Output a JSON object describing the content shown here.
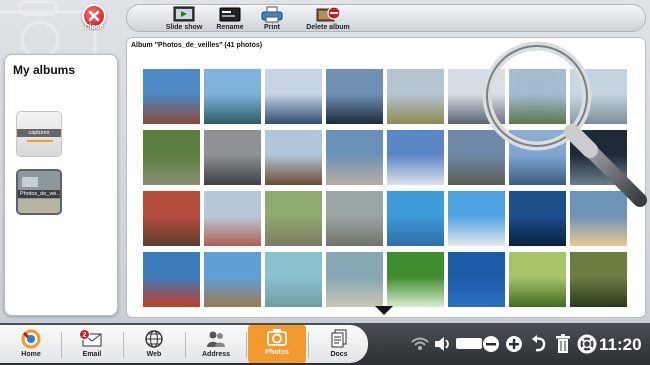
{
  "window": {
    "close_label": "Close"
  },
  "toolbar": {
    "buttons": [
      {
        "label": "Slide show",
        "icon": "slideshow-icon"
      },
      {
        "label": "Rename",
        "icon": "rename-icon"
      },
      {
        "label": "Print",
        "icon": "printer-icon"
      },
      {
        "label": "Delete album",
        "icon": "delete-album-icon"
      }
    ]
  },
  "sidebar": {
    "title": "My albums",
    "albums": [
      {
        "label": "captures"
      },
      {
        "label": "Photos_de_vei..."
      }
    ]
  },
  "main": {
    "title": "Album \"Photos_de_veilles\" (41 photos)"
  },
  "photos": [
    {
      "top": "#4f88c6",
      "bottom": "#8a4a3c"
    },
    {
      "top": "#7fb2dd",
      "bottom": "#2e5d62"
    },
    {
      "top": "#c7d4e6",
      "bottom": "#2f4d6e"
    },
    {
      "top": "#6f90b2",
      "bottom": "#1e2a3a"
    },
    {
      "top": "#b6c4d0",
      "bottom": "#8d8a55"
    },
    {
      "top": "#d6dde4",
      "bottom": "#59636e"
    },
    {
      "top": "#9db7cf",
      "bottom": "#4b6a3a"
    },
    {
      "top": "#c4d3df",
      "bottom": "#7d8e9a"
    },
    {
      "top": "#5a7e3d",
      "bottom": "#8a8f74"
    },
    {
      "top": "#8e9296",
      "bottom": "#3d4043"
    },
    {
      "top": "#b1c6d8",
      "bottom": "#6e4b32"
    },
    {
      "top": "#6c91b8",
      "bottom": "#b6b0a0"
    },
    {
      "top": "#5b86c5",
      "bottom": "#dce3ea"
    },
    {
      "top": "#6e8aa8",
      "bottom": "#5c5d52"
    },
    {
      "top": "#7fa5d0",
      "bottom": "#3b5e83"
    },
    {
      "top": "#1f2a36",
      "bottom": "#6d7e8f"
    },
    {
      "top": "#b44c3c",
      "bottom": "#5b3f30"
    },
    {
      "top": "#b8c8d8",
      "bottom": "#b05f55"
    },
    {
      "top": "#8faa6e",
      "bottom": "#7d7a65"
    },
    {
      "top": "#9aa6a6",
      "bottom": "#6f7467"
    },
    {
      "top": "#3f9ad8",
      "bottom": "#2f6fa7"
    },
    {
      "top": "#4ea2e2",
      "bottom": "#e3e8ec"
    },
    {
      "top": "#1b4e8b",
      "bottom": "#0a213f"
    },
    {
      "top": "#6e93b8",
      "bottom": "#e7c98f"
    },
    {
      "top": "#3d7bbd",
      "bottom": "#c13e25"
    },
    {
      "top": "#5f9fd8",
      "bottom": "#9a7a52"
    },
    {
      "top": "#8bc0cf",
      "bottom": "#6e9fa1"
    },
    {
      "top": "#86a7b3",
      "bottom": "#c9c6b4"
    },
    {
      "top": "#3f8d2e",
      "bottom": "#d8ecd0"
    },
    {
      "top": "#1c5ba8",
      "bottom": "#2a6fc0"
    },
    {
      "top": "#a7c46a",
      "bottom": "#3f6b22"
    },
    {
      "top": "#6b7d43",
      "bottom": "#2b3b1a"
    }
  ],
  "taskbar": {
    "items": [
      {
        "label": "Home",
        "icon": "home-icon"
      },
      {
        "label": "Email",
        "icon": "email-icon",
        "badge": "2"
      },
      {
        "label": "Web",
        "icon": "globe-icon"
      },
      {
        "label": "Address",
        "icon": "address-book-icon"
      },
      {
        "label": "Photos",
        "icon": "camera-icon",
        "active": true
      },
      {
        "label": "Docs",
        "icon": "documents-icon"
      }
    ],
    "clock": "11:20"
  },
  "colors": {
    "accent": "#f39a2e",
    "close": "#c4161c",
    "taskbar": "#2c3034"
  }
}
